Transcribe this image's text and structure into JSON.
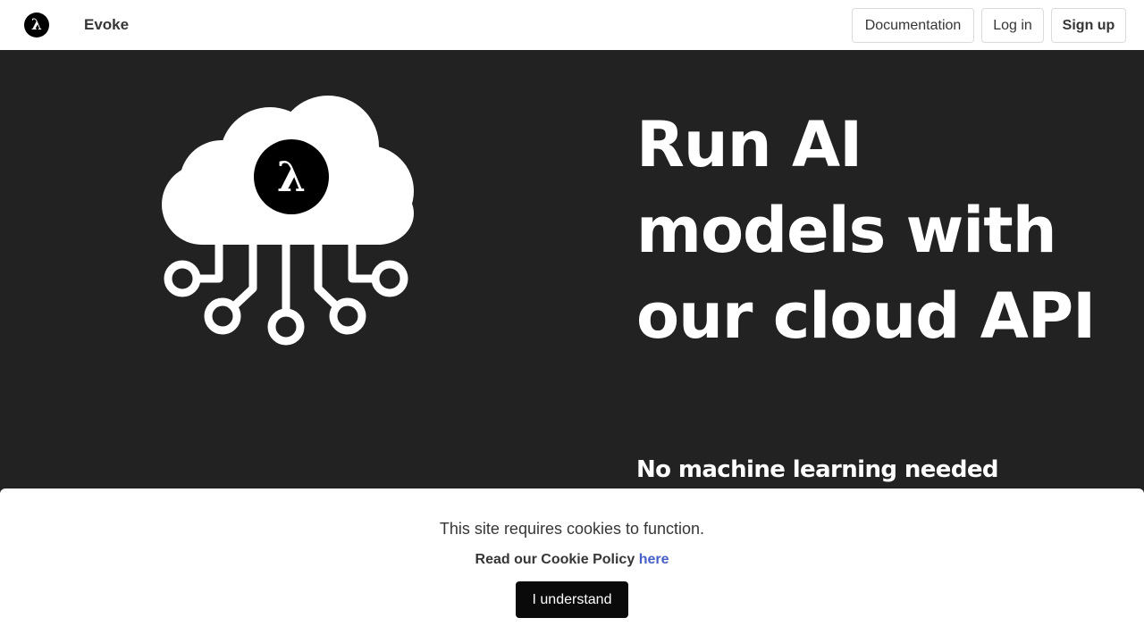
{
  "navbar": {
    "logo_glyph": "λ",
    "brand_name": "Evoke",
    "documentation_label": "Documentation",
    "login_label": "Log in",
    "signup_label": "Sign up"
  },
  "hero": {
    "illustration_icon": "cloud-circuit-lambda-icon",
    "illustration_glyph": "λ",
    "title": "Run AI models with our cloud API",
    "subtitle": "No machine learning needed"
  },
  "cookie_banner": {
    "message": "This site requires cookies to function.",
    "policy_text": "Read our Cookie Policy",
    "policy_link_label": "here",
    "accept_label": "I understand"
  },
  "colors": {
    "hero_background": "#222222",
    "navbar_background": "#ffffff",
    "link": "#485fc7",
    "primary_button": "#0a0a0a"
  }
}
